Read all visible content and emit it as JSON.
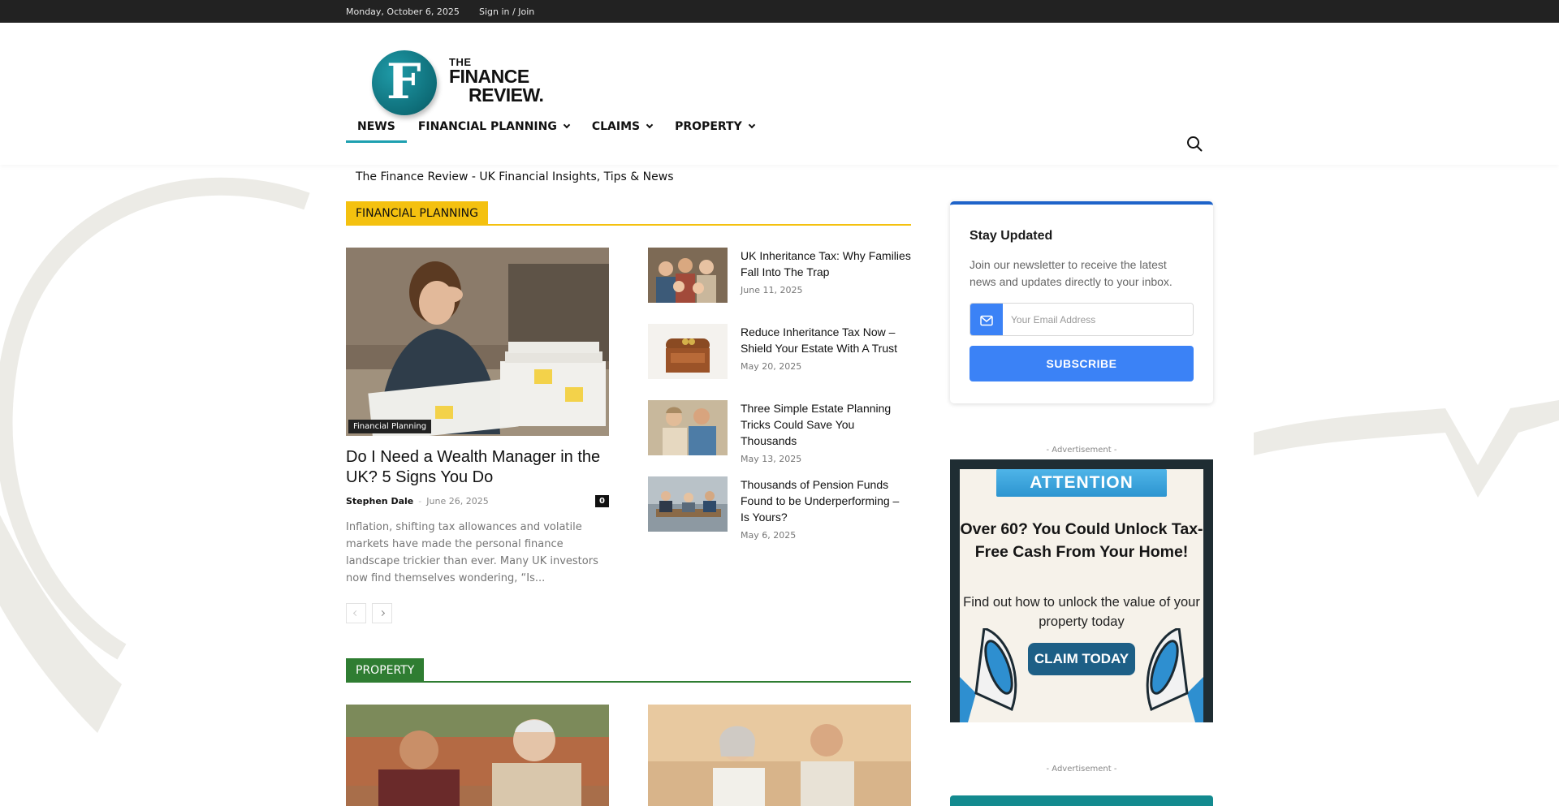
{
  "topbar": {
    "date": "Monday, October 6, 2025",
    "signin": "Sign in / Join"
  },
  "brand": {
    "logo_letter": "F",
    "logo_the": "THE",
    "logo_finance": "FINANCE",
    "logo_review": "REVIEW."
  },
  "nav": [
    {
      "label": "NEWS",
      "active": true
    },
    {
      "label": "FINANCIAL PLANNING",
      "dropdown": true
    },
    {
      "label": "CLAIMS",
      "dropdown": true
    },
    {
      "label": "PROPERTY",
      "dropdown": true
    }
  ],
  "tagline": "The Finance Review - UK Financial Insights, Tips & News",
  "financial_planning": {
    "title": "FINANCIAL PLANNING",
    "featured": {
      "category": "Financial Planning",
      "title": "Do I Need a Wealth Manager in the UK? 5 Signs You Do",
      "author": "Stephen Dale",
      "separator": "-",
      "date": "June 26, 2025",
      "comments": "0",
      "excerpt": "Inflation, shifting tax allowances and volatile markets have made the personal finance landscape trickier than ever. Many UK investors now find themselves wondering, “Is..."
    },
    "list": [
      {
        "title": "UK Inheritance Tax: Why Families Fall Into The Trap",
        "date": "June 11, 2025"
      },
      {
        "title": "Reduce Inheritance Tax Now – Shield Your Estate With A Trust",
        "date": "May 20, 2025"
      },
      {
        "title": "Three Simple Estate Planning Tricks Could Save You Thousands",
        "date": "May 13, 2025"
      },
      {
        "title": "Thousands of Pension Funds Found to be Underperforming – Is Yours?",
        "date": "May 6, 2025"
      }
    ]
  },
  "property": {
    "title": "PROPERTY"
  },
  "newsletter": {
    "title": "Stay Updated",
    "text": "Join our newsletter to receive the latest news and updates directly to your inbox.",
    "placeholder": "Your Email Address",
    "button": "SUBSCRIBE"
  },
  "ads": {
    "label": "- Advertisement -",
    "banner": "ATTENTION",
    "headline": "Over 60? You Could Unlock Tax-Free Cash From Your Home!",
    "sub": "Find out how to unlock the value of your property today",
    "cta": "CLAIM TODAY"
  },
  "colors": {
    "topbar": "#222222",
    "nav_accent": "#1ea0b0",
    "financial_planning": "#f4c10f",
    "property": "#2f7d32",
    "newsletter_accent": "#3b82f6"
  }
}
